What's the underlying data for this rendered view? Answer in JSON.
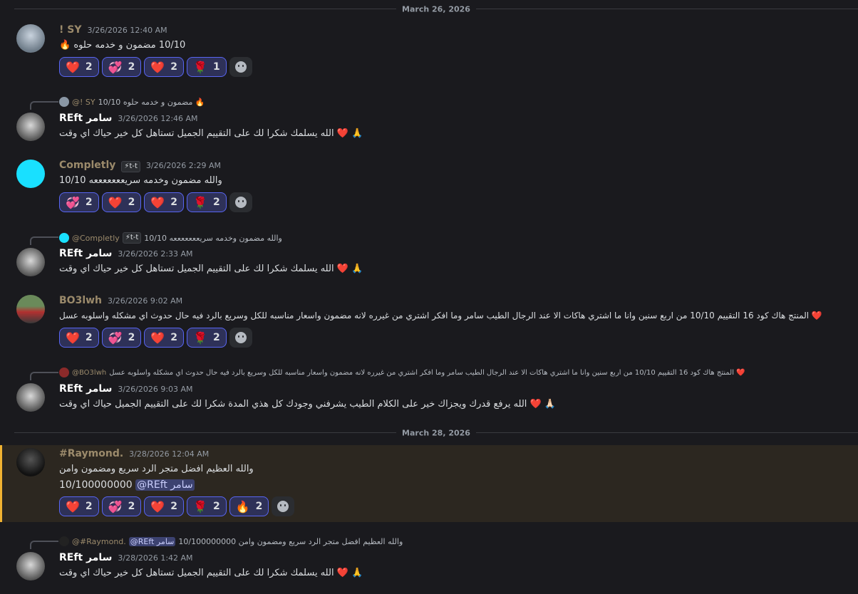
{
  "dividers": [
    {
      "label": "March 26, 2026"
    },
    {
      "label": "March 28, 2026"
    }
  ],
  "messages": [
    {
      "author": "! SY",
      "author_color": "#9b8a6b",
      "timestamp": "3/26/2026 12:40 AM",
      "text": "10/10 مضمون و خدمه حلوه 🔥",
      "reactions": [
        {
          "emoji": "❤️",
          "count": "2"
        },
        {
          "emoji": "💞",
          "count": "2"
        },
        {
          "emoji": "❤️",
          "count": "2"
        },
        {
          "emoji": "🌹",
          "count": "1"
        }
      ]
    },
    {
      "reply_author": "@! SY",
      "reply_text": "10/10 مضمون و خدمه حلوه 🔥",
      "author": "REft سامر",
      "author_color": "#ffffff",
      "timestamp": "3/26/2026 12:46 AM",
      "text": "الله يسلمك شكرا لك على التقييم الجميل تستاهل كل خير حياك اي وقت ❤️ 🙏"
    },
    {
      "author": "Completly",
      "author_tag": "⚡t-t",
      "author_color": "#9b8a6b",
      "timestamp": "3/26/2026 2:29 AM",
      "text": "والله مضمون وخدمه سريعععععععه 10/10",
      "reactions": [
        {
          "emoji": "💞",
          "count": "2"
        },
        {
          "emoji": "❤️",
          "count": "2"
        },
        {
          "emoji": "❤️",
          "count": "2"
        },
        {
          "emoji": "🌹",
          "count": "2"
        }
      ]
    },
    {
      "reply_author": "@Completly",
      "reply_tag": "⚡t-t",
      "reply_text": "والله مضمون وخدمه سريعععععععه 10/10",
      "author": "REft سامر",
      "author_color": "#ffffff",
      "timestamp": "3/26/2026 2:33 AM",
      "text": "الله يسلمك شكرا لك على التقييم الجميل تستاهل كل خير حياك اي وقت ❤️ 🙏"
    },
    {
      "author": "BO3lwh",
      "author_color": "#9b8a6b",
      "timestamp": "3/26/2026 9:02 AM",
      "text": "المنتج هاك كود 16 التقييم 10/10 من اربع سنين وانا ما اشتري هاكات الا عند الرجال الطيب سامر وما افكر اشتري من غيرره لانه مضمون واسعار مناسبه للكل وسريع بالرد فيه حال حدوث اي مشكله واسلوبه عسل ❤️",
      "reactions": [
        {
          "emoji": "❤️",
          "count": "2"
        },
        {
          "emoji": "💞",
          "count": "2"
        },
        {
          "emoji": "❤️",
          "count": "2"
        },
        {
          "emoji": "🌹",
          "count": "2"
        }
      ]
    },
    {
      "reply_author": "@BO3lwh",
      "reply_text": "المنتج هاك كود 16 التقييم 10/10 من اربع سنين وانا ما اشتري هاكات الا عند الرجال الطيب سامر وما افكر اشتري من غيرره لانه مضمون واسعار مناسبه للكل وسريع بالرد فيه حال حدوث اي مشكله واسلوبه عسل ❤️",
      "author": "REft سامر",
      "author_color": "#ffffff",
      "timestamp": "3/26/2026 9:03 AM",
      "text": "الله يرفع قدرك ويجزاك خير على الكلام الطيب يشرفني وجودك كل هذي المدة شكرا لك على التقييم الجميل حياك اي وقت ❤️ 🙏🏻"
    },
    {
      "author": "#Raymond.",
      "author_color": "#9b8a6b",
      "timestamp": "3/28/2026 12:04 AM",
      "text": "والله العظيم افضل متجر الرد سريع ومضمون  وامن",
      "text2": "10/100000000",
      "mention": "@REft سامر",
      "reactions": [
        {
          "emoji": "❤️",
          "count": "2"
        },
        {
          "emoji": "💞",
          "count": "2"
        },
        {
          "emoji": "❤️",
          "count": "2"
        },
        {
          "emoji": "🌹",
          "count": "2"
        },
        {
          "emoji": "🔥",
          "count": "2"
        }
      ]
    },
    {
      "reply_author": "@#Raymond.",
      "reply_mention": "@REft سامر",
      "reply_text": "10/100000000  والله العظيم افضل متجر الرد سريع ومضمون  وامن",
      "author": "REft سامر",
      "author_color": "#ffffff",
      "timestamp": "3/28/2026 1:42 AM",
      "text": "الله يسلمك شكرا لك على التقييم الجميل تستاهل كل خير حياك اي وقت ❤️ 🙏"
    }
  ]
}
